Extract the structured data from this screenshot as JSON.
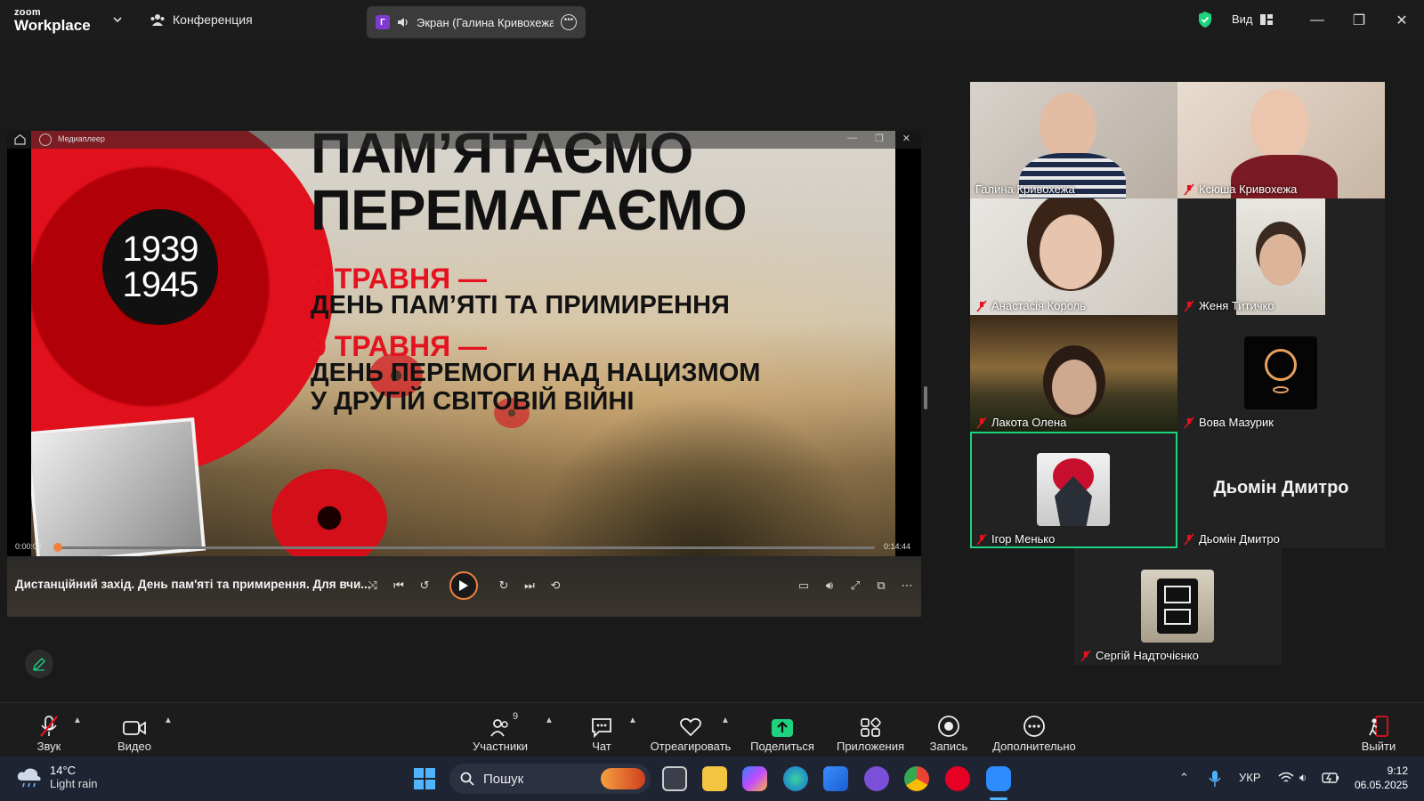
{
  "topbar": {
    "logo_line1": "zoom",
    "logo_line2": "Workplace",
    "conference_label": "Конференция",
    "screen_share_label": "Экран (Галина Кривохежа)",
    "share_avatar_letter": "Г",
    "view_label": "Вид",
    "security_color": "#1dd37e"
  },
  "player": {
    "app_name": "Медиаплеер",
    "headline_line1": "ПАМ’ЯТАЄМО",
    "headline_line2": "ПЕРЕМАГАЄМО",
    "badge_year1": "1939",
    "badge_year2": "1945",
    "date1": "8 ТРАВНЯ —",
    "date1_text": "ДЕНЬ ПАМ’ЯТІ ТА ПРИМИРЕННЯ",
    "date2": "9 ТРАВНЯ —",
    "date2_text_line1": "ДЕНЬ ПЕРЕМОГИ НАД НАЦИЗМОМ",
    "date2_text_line2": "У ДРУГІЙ СВІТОВІЙ ВІЙНІ",
    "time_elapsed": "0:00:02",
    "time_total": "0:14:44",
    "progress_fraction": 0.003,
    "caption": "Дистанційний захід.  День пам'яті та примирення. Для вчи...",
    "accent_color": "#f08040"
  },
  "gallery": {
    "tiles": [
      {
        "name": "Галина Кривохежа",
        "muted": false,
        "active": false
      },
      {
        "name": "Ксюша Кривохежа",
        "muted": true,
        "active": false
      },
      {
        "name": "Анастасія Король",
        "muted": true,
        "active": false
      },
      {
        "name": "Женя Титичко",
        "muted": true,
        "active": false
      },
      {
        "name": "Лакота Олена",
        "muted": true,
        "active": false
      },
      {
        "name": "Вова Мазурик",
        "muted": true,
        "active": false
      },
      {
        "name": "Ігор Менько",
        "muted": true,
        "active": true
      },
      {
        "name": "Дьомін Дмитро",
        "muted": true,
        "active": false,
        "display_text": "Дьомін Дмитро"
      },
      {
        "name": "Сергій Надточієнко",
        "muted": true,
        "active": false
      }
    ]
  },
  "toolbar": {
    "audio": "Звук",
    "video": "Видео",
    "participants": "Участники",
    "participants_count": "9",
    "chat": "Чат",
    "react": "Отреагировать",
    "share": "Поделиться",
    "apps": "Приложения",
    "record": "Запись",
    "more": "Дополнительно",
    "leave": "Выйти",
    "share_color": "#1dd37e",
    "leave_color": "#e5121f"
  },
  "taskbar": {
    "temperature": "14°C",
    "weather": "Light rain",
    "search_placeholder": "Пошук",
    "language": "УКР",
    "time": "9:12",
    "date": "06.05.2025"
  }
}
